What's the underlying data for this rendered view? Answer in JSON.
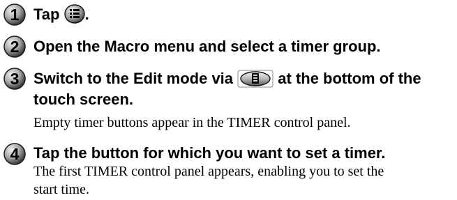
{
  "steps": [
    {
      "number": "1",
      "title_before_icon": "Tap ",
      "icon": "list-menu-icon",
      "title_after_icon": "."
    },
    {
      "number": "2",
      "title": "Open the Macro menu and select a timer group."
    },
    {
      "number": "3",
      "title_before_icon": "Switch to the Edit mode via ",
      "icon": "edit-mode-button-icon",
      "title_after_icon": " at the bottom of the",
      "title_line2": "touch screen.",
      "body": "Empty timer buttons appear in the TIMER control panel."
    },
    {
      "number": "4",
      "title": "Tap the button for which you want to set a timer.",
      "body_line1": "The first TIMER control panel appears, enabling you to set the",
      "body_line2": "start time."
    }
  ],
  "colors": {
    "badge_light": "#e6e6e6",
    "badge_mid": "#9a9a9a",
    "badge_dark": "#3a3a3a",
    "text": "#000000"
  }
}
